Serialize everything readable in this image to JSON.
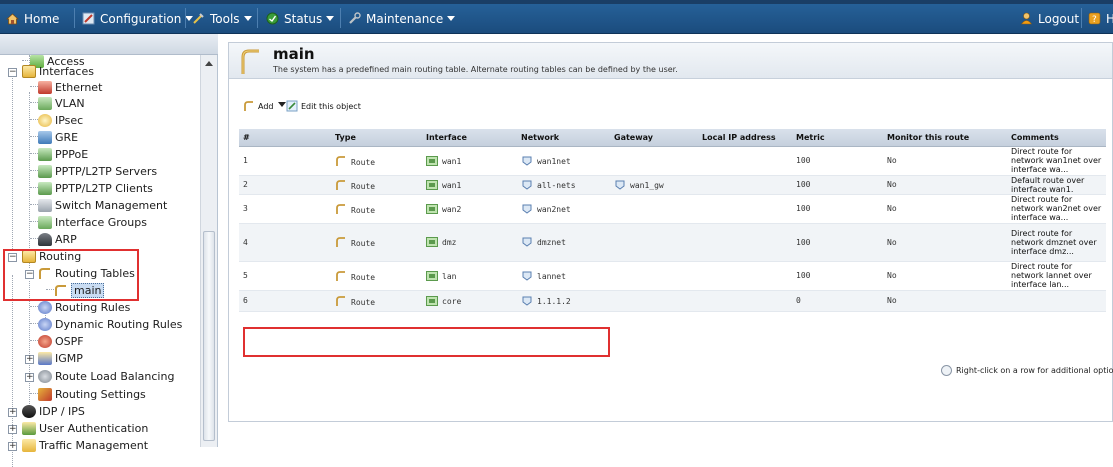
{
  "topbar": {
    "home": "Home",
    "configuration": "Configuration",
    "tools": "Tools",
    "status": "Status",
    "maintenance": "Maintenance",
    "logout": "Logout",
    "help": "H"
  },
  "tree": {
    "access": "Access",
    "interfaces": "Interfaces",
    "ethernet": "Ethernet",
    "vlan": "VLAN",
    "ipsec": "IPsec",
    "gre": "GRE",
    "pppoe": "PPPoE",
    "pptp_servers": "PPTP/L2TP Servers",
    "pptp_clients": "PPTP/L2TP Clients",
    "switch_management": "Switch Management",
    "interface_groups": "Interface Groups",
    "arp": "ARP",
    "routing": "Routing",
    "routing_tables": "Routing Tables",
    "main": "main",
    "routing_rules": "Routing Rules",
    "dynamic_routing_rules": "Dynamic Routing Rules",
    "ospf": "OSPF",
    "igmp": "IGMP",
    "route_load_balancing": "Route Load Balancing",
    "routing_settings": "Routing Settings",
    "idp_ips": "IDP / IPS",
    "user_authentication": "User Authentication",
    "traffic_management": "Traffic Management"
  },
  "main": {
    "title": "main",
    "description": "The system has a predefined main routing table. Alternate routing tables can be defined by the user.",
    "add_label": "Add",
    "edit_label": "Edit this object",
    "columns": [
      "#",
      "Type",
      "Interface",
      "Network",
      "Gateway",
      "Local IP address",
      "Metric",
      "Monitor this route",
      "Comments"
    ],
    "rows": [
      {
        "num": "1",
        "type": "Route",
        "interface": "wan1",
        "network": "wan1net",
        "gateway": "",
        "local_ip": "",
        "metric": "100",
        "monitor": "No",
        "comment": "Direct route for network wan1net over interface wa..."
      },
      {
        "num": "2",
        "type": "Route",
        "interface": "wan1",
        "network": "all-nets",
        "gateway": "wan1_gw",
        "local_ip": "",
        "metric": "100",
        "monitor": "No",
        "comment": "Default route over interface wan1."
      },
      {
        "num": "3",
        "type": "Route",
        "interface": "wan2",
        "network": "wan2net",
        "gateway": "",
        "local_ip": "",
        "metric": "100",
        "monitor": "No",
        "comment": "Direct route for network wan2net over interface wa..."
      },
      {
        "num": "4",
        "type": "Route",
        "interface": "dmz",
        "network": "dmznet",
        "gateway": "",
        "local_ip": "",
        "metric": "100",
        "monitor": "No",
        "comment": "Direct route for network dmznet over interface dmz..."
      },
      {
        "num": "5",
        "type": "Route",
        "interface": "lan",
        "network": "lannet",
        "gateway": "",
        "local_ip": "",
        "metric": "100",
        "monitor": "No",
        "comment": "Direct route for network lannet over interface lan..."
      },
      {
        "num": "6",
        "type": "Route",
        "interface": "core",
        "network": "1.1.1.2",
        "gateway": "",
        "local_ip": "",
        "metric": "0",
        "monitor": "No",
        "comment": ""
      }
    ],
    "hint": "Right-click on a row for additional options."
  },
  "colors": {
    "topbar": "#1f5489",
    "highlight": "#e03030",
    "header": "#c5d0dd"
  }
}
